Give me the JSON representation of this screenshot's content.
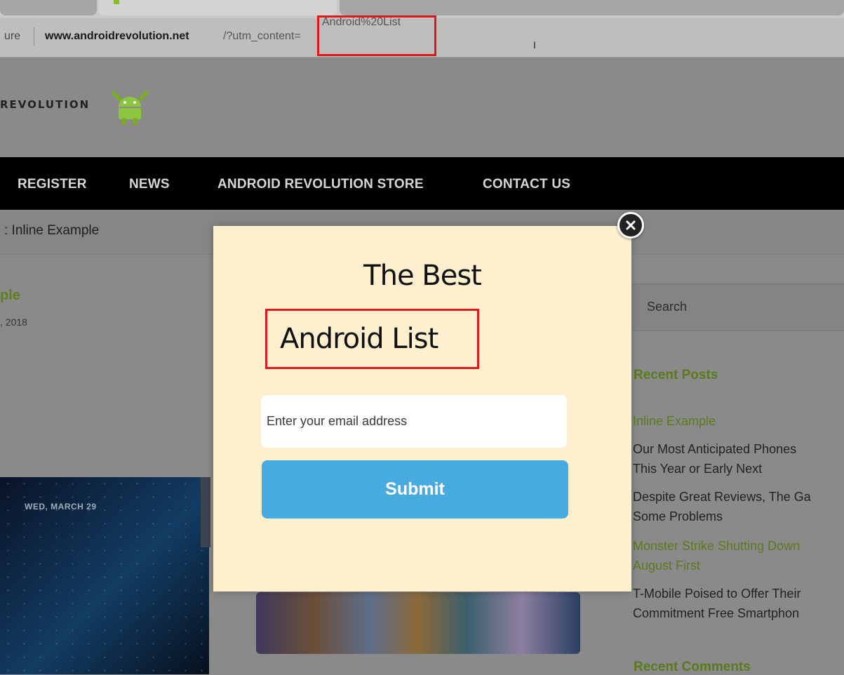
{
  "browser": {
    "url_prefix": "ure",
    "url_domain": "www.androidrevolution.net",
    "url_path": "/?utm_content=",
    "url_highlight": "Android%20List",
    "cursor_glyph": "I"
  },
  "site": {
    "logo_text": "REVOLUTION",
    "logo_icon": "android-robot-icon",
    "nav": {
      "register": "REGISTER",
      "news": "NEWS",
      "store": "ANDROID REVOLUTION STORE",
      "contact": "CONTACT US"
    },
    "breadcrumb": ": Inline Example",
    "post": {
      "title": "ple",
      "date": ", 2018",
      "image_date_label": "WED, MARCH 29"
    }
  },
  "sidebar": {
    "search_placeholder": "Search",
    "recent_posts_heading": "Recent Posts",
    "recent_posts": [
      {
        "text": "Inline Example"
      },
      {
        "line1": "Our Most Anticipated Phones",
        "line2": "This Year or Early Next"
      },
      {
        "line1": "Despite Great Reviews, The Ga",
        "line2": "Some Problems"
      },
      {
        "line1": "Monster Strike Shutting Down",
        "line2": "August First"
      },
      {
        "line1": "T-Mobile Poised to Offer Their",
        "line2": "Commitment Free Smartphon"
      }
    ],
    "recent_comments_heading": "Recent Comments"
  },
  "modal": {
    "title": "The Best",
    "subtitle": "Android List",
    "email_placeholder": "Enter your email address",
    "submit_label": "Submit",
    "close_icon": "close-icon"
  },
  "colors": {
    "modal_bg": "#fef0cf",
    "submit_bg": "#48abe0",
    "highlight_red": "#e01818",
    "link_green": "#5a7a1d",
    "nav_bg": "#000000"
  }
}
